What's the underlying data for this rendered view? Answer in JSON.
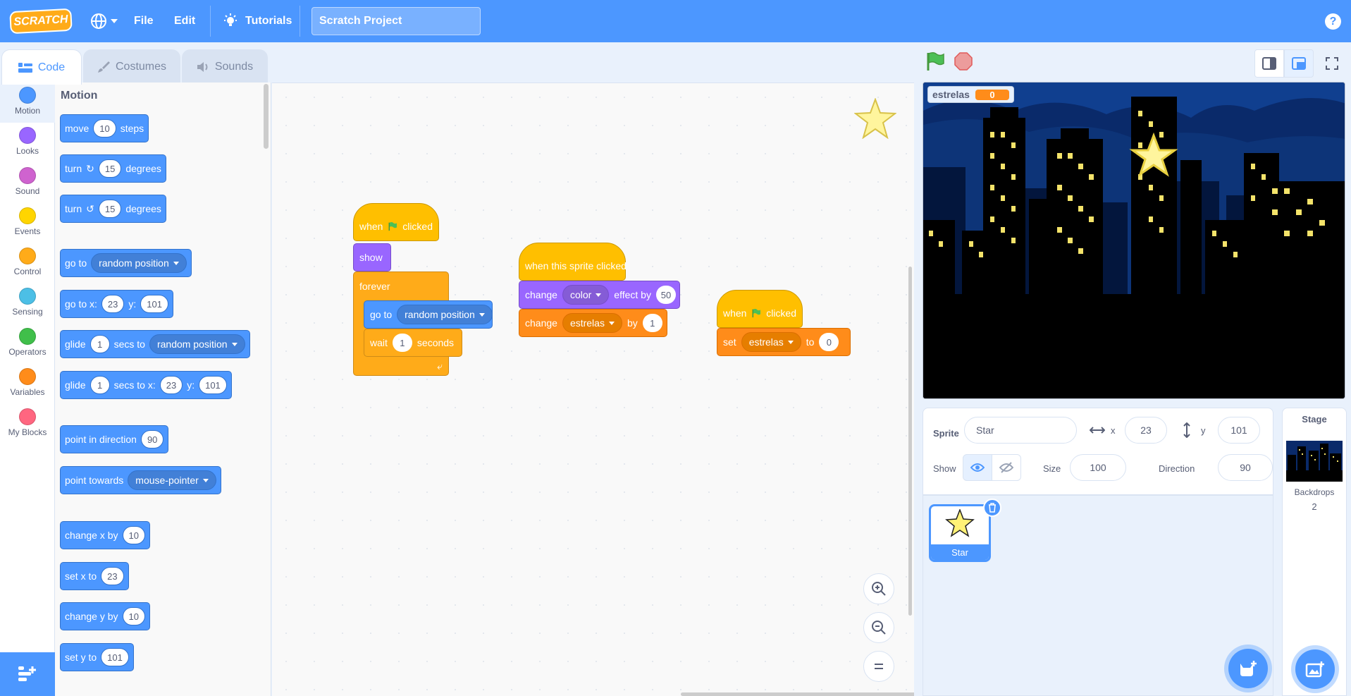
{
  "menubar": {
    "logo": "SCRATCH",
    "file": "File",
    "edit": "Edit",
    "tutorials": "Tutorials",
    "project_title": "Scratch Project",
    "help": "?"
  },
  "tabs": {
    "code": "Code",
    "costumes": "Costumes",
    "sounds": "Sounds"
  },
  "categories": [
    {
      "label": "Motion",
      "color": "#4c97ff"
    },
    {
      "label": "Looks",
      "color": "#9966ff"
    },
    {
      "label": "Sound",
      "color": "#cf63cf"
    },
    {
      "label": "Events",
      "color": "#ffd500"
    },
    {
      "label": "Control",
      "color": "#ffab19"
    },
    {
      "label": "Sensing",
      "color": "#4cbfe6"
    },
    {
      "label": "Operators",
      "color": "#40bf4a"
    },
    {
      "label": "Variables",
      "color": "#ff8c1a"
    },
    {
      "label": "My Blocks",
      "color": "#ff6680"
    }
  ],
  "palette": {
    "title": "Motion",
    "move": {
      "a": "move",
      "v": "10",
      "b": "steps"
    },
    "turn_right": {
      "a": "turn",
      "v": "15",
      "b": "degrees"
    },
    "turn_left": {
      "a": "turn",
      "v": "15",
      "b": "degrees"
    },
    "goto": {
      "a": "go to",
      "dd": "random position"
    },
    "gotoxy": {
      "a": "go to x:",
      "x": "23",
      "b": "y:",
      "y": "101"
    },
    "glide": {
      "a": "glide",
      "v": "1",
      "b": "secs to",
      "dd": "random position"
    },
    "glidexy": {
      "a": "glide",
      "v": "1",
      "b": "secs to x:",
      "x": "23",
      "c": "y:",
      "y": "101"
    },
    "point_dir": {
      "a": "point in direction",
      "v": "90"
    },
    "point_towards": {
      "a": "point towards",
      "dd": "mouse-pointer"
    },
    "change_x": {
      "a": "change x by",
      "v": "10"
    },
    "set_x": {
      "a": "set x to",
      "v": "23"
    },
    "change_y": {
      "a": "change y by",
      "v": "10"
    },
    "set_y": {
      "a": "set y to",
      "v": "101"
    }
  },
  "scripts": {
    "s1": {
      "when": "when",
      "clicked": "clicked",
      "show": "show",
      "forever": "forever",
      "goto": "go to",
      "goto_dd": "random position",
      "wait": "wait",
      "wait_v": "1",
      "seconds": "seconds"
    },
    "s2": {
      "hat": "when this sprite clicked",
      "change": "change",
      "effect_dd": "color",
      "effect_by": "effect by",
      "effect_v": "50",
      "change2": "change",
      "var_dd": "estrelas",
      "by": "by",
      "by_v": "1"
    },
    "s3": {
      "when": "when",
      "clicked": "clicked",
      "set": "set",
      "var_dd": "estrelas",
      "to": "to",
      "to_v": "0"
    }
  },
  "stage": {
    "monitor_label": "estrelas",
    "monitor_value": "0"
  },
  "sprite_info": {
    "sprite_label": "Sprite",
    "sprite_name": "Star",
    "x_label": "x",
    "x": "23",
    "y_label": "y",
    "y": "101",
    "show_label": "Show",
    "size_label": "Size",
    "size": "100",
    "direction_label": "Direction",
    "direction": "90"
  },
  "sprite_list": [
    {
      "name": "Star"
    }
  ],
  "stage_pane": {
    "title": "Stage",
    "backdrops_label": "Backdrops",
    "backdrops_count": "2"
  },
  "colors": {
    "accent": "#4c97ff",
    "events": "#ffbf00",
    "control": "#ffab19",
    "looks": "#9966ff",
    "variables": "#ff8c1a"
  }
}
